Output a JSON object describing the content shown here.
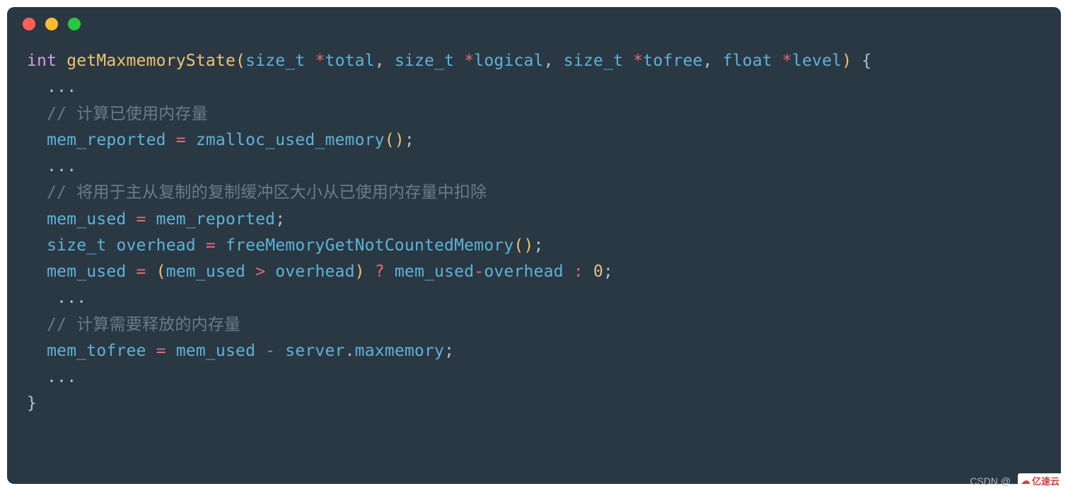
{
  "window": {
    "dots": {
      "red": "#ff5f57",
      "yellow": "#febc2e",
      "green": "#28c840"
    },
    "bg": "#2a3844"
  },
  "code": {
    "l1_int": "int",
    "l1_fn": "getMaxmemoryState",
    "l1_p_open": "(",
    "l1_t1": "size_t",
    "l1_star": "*",
    "l1_a1": "total",
    "l1_c": ", ",
    "l1_t2": "size_t",
    "l1_a2": "logical",
    "l1_t3": "size_t",
    "l1_a3": "tofree",
    "l1_t4": "float",
    "l1_a4": "level",
    "l1_p_close": ")",
    "l1_brace": " {",
    "l2": "  ...",
    "l3": "  // 计算已使用内存量",
    "l4_pre": "  mem_reported ",
    "l4_eq": "=",
    "l4_fn": " zmalloc_used_memory",
    "l4_paren": "()",
    "l4_semi": ";",
    "l5": "  ...",
    "l6": "  // 将用于主从复制的复制缓冲区大小从已使用内存量中扣除",
    "l7_lhs": "  mem_used ",
    "l7_eq": "=",
    "l7_rhs": " mem_reported",
    "l7_semi": ";",
    "l8_t": "size_t",
    "l8_id": " overhead ",
    "l8_eq": "=",
    "l8_fn": " freeMemoryGetNotCountedMemory",
    "l8_paren": "()",
    "l8_semi": ";",
    "l9_lhs": "  mem_used ",
    "l9_eq": "=",
    "l9_po": " (",
    "l9_a": "mem_used ",
    "l9_gt": ">",
    "l9_b": " overhead",
    "l9_pc": ") ",
    "l9_q": "?",
    "l9_c": " mem_used",
    "l9_minus": "-",
    "l9_d": "overhead ",
    "l9_colon": ":",
    "l9_zero": " 0",
    "l9_semi": ";",
    "l10": "   ...",
    "l11": "  // 计算需要释放的内存量",
    "l12_lhs": "  mem_tofree ",
    "l12_eq": "=",
    "l12_a": " mem_used ",
    "l12_minus": "-",
    "l12_b": " server",
    "l12_dot": ".",
    "l12_c": "maxmemory",
    "l12_semi": ";",
    "l13": "  ...",
    "l14": "}"
  },
  "watermark": {
    "csdn": "CSDN @.",
    "logo": "亿速云"
  }
}
